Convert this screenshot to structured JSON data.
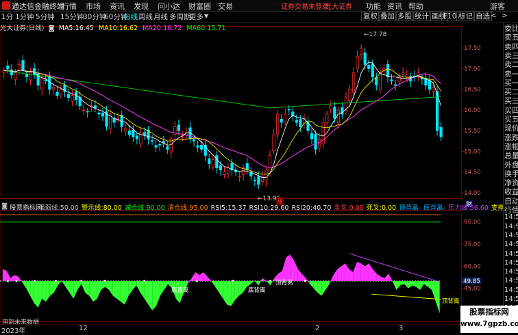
{
  "titlebar": {
    "app_name": "通达信金融终端",
    "menu": [
      "行情",
      "市场",
      "资讯",
      "发现",
      "问小达",
      "财富圈",
      "交易"
    ],
    "login_warning": "证券交易未登录",
    "broker": "光大证券",
    "right_menu": [
      "功能",
      "资讯",
      "帮助"
    ],
    "user": "游客"
  },
  "toolbar": {
    "periods": [
      "1分",
      "1分钟",
      "5分钟",
      "15分钟",
      "30分钟",
      "60分钟",
      "日线",
      "周线",
      "月线",
      "多周期",
      "更多"
    ],
    "right_buttons": [
      "复权",
      "叠加",
      "多股",
      "统计",
      "画线",
      "F10",
      "标记",
      "自选"
    ],
    "chevron_left": "<",
    "chevron_right": ">"
  },
  "chart_header": {
    "stock": "光大证券(日线)",
    "ma5_label": "MA5:",
    "ma5": "16.45",
    "ma10_label": "MA10:",
    "ma10": "16.62",
    "ma20_label": "MA20:",
    "ma20": "16.72",
    "ma60_label": "MA60:",
    "ma60": "15.71"
  },
  "price_axis": [
    "17.50",
    "17.00",
    "16.50",
    "16.00",
    "15.50",
    "15.00",
    "14.50",
    "14.00"
  ],
  "price_annotations": {
    "high": "17.78",
    "low": "13.95",
    "marker": "涨"
  },
  "indicator_header": {
    "name": "股票指标网",
    "items": [
      {
        "label": "强弱线:",
        "value": "50.00",
        "color": "#c0c0c0"
      },
      {
        "label": "警示线:",
        "value": "80.00",
        "color": "#ffff00"
      },
      {
        "label": "减仓线:",
        "value": "90.00",
        "color": "#00ff00"
      },
      {
        "label": "清仓线:",
        "value": "95.00",
        "color": "#ff8000"
      },
      {
        "label": "RSI5:",
        "value": "15.37",
        "color": "#e0e0e0"
      },
      {
        "label": "RSI10:",
        "value": "29.60",
        "color": "#e0e0e0"
      },
      {
        "label": "RSI20:",
        "value": "40.70",
        "color": "#e0e0e0"
      },
      {
        "label": "金叉:",
        "value": "0.00",
        "color": "#ff4040"
      },
      {
        "label": "死叉:",
        "value": "0.00",
        "color": "#ffff00"
      },
      {
        "label": "顶背离",
        "value": "-",
        "color": "#00b0ff"
      },
      {
        "label": "底背离",
        "value": "-",
        "color": "#00b0ff"
      },
      {
        "label": "压力线:",
        "value": "56.60",
        "color": "#c040ff"
      },
      {
        "label": "支撑线:",
        "value": "43.62",
        "color": "#ffff00"
      }
    ]
  },
  "indicator_axis": [
    "90.00",
    "75.00",
    "60.00",
    "45.00",
    "30.00"
  ],
  "indicator_current": "49.85",
  "indicator_annotations": [
    "底背离",
    "底背离",
    "顶背离",
    "顶背离"
  ],
  "indicator_note": "用到未来数据",
  "bottom_axis": [
    "2023年",
    "12",
    "2",
    "3"
  ],
  "right_list": [
    "委比",
    "卖五",
    "卖四",
    "卖三",
    "卖二",
    "卖一",
    "买一",
    "买二",
    "买三",
    "买四",
    "买五",
    "现价",
    "涨跌",
    "涨幅",
    "总量",
    "外盘",
    "换手",
    "净资",
    "收益",
    "自动",
    "行情",
    "14:5",
    "14:5",
    "14:5",
    "14:5",
    "14:5",
    "14:5",
    "14:5",
    "14:5",
    "14:5",
    "14:5",
    "14:5",
    "14:5",
    "L"
  ],
  "right_top": "L",
  "finance_marker": "财",
  "watermark": {
    "line1": "股票指标网",
    "line2": "www.7gpzb.com"
  },
  "colors": {
    "up": "#ff3333",
    "down": "#00ffff",
    "ma5": "#ffffff",
    "ma10": "#ffff00",
    "ma20": "#ff40ff",
    "ma60": "#00ff00",
    "pink": "#ff40ff",
    "green": "#33ff33",
    "grid": "#7a0000"
  }
}
